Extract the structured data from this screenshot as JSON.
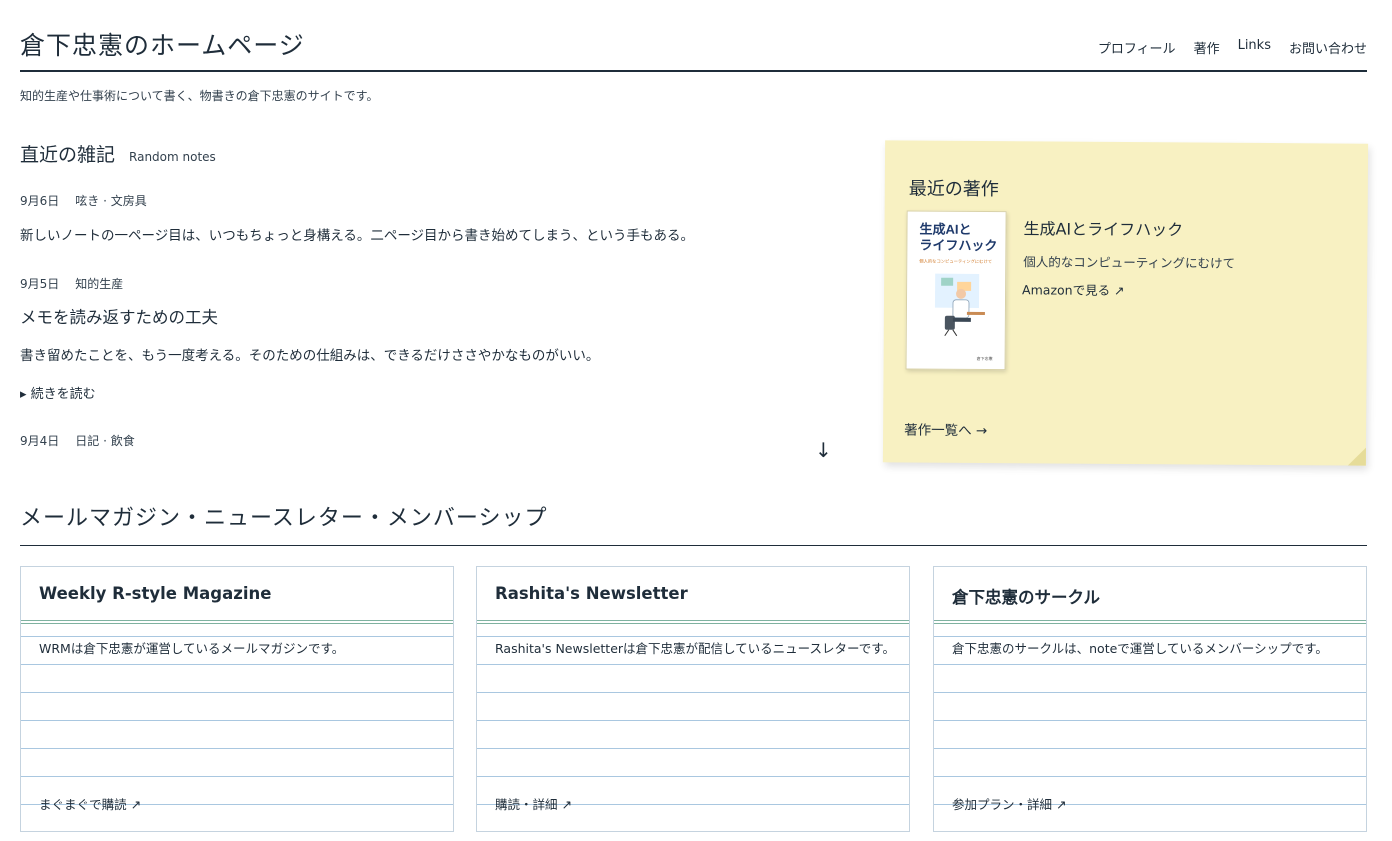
{
  "header": {
    "site_title": "倉下忠憲のホームページ",
    "nav": [
      "プロフィール",
      "著作",
      "Links",
      "お問い合わせ"
    ],
    "tagline": "知的生産や仕事術について書く、物書きの倉下忠憲のサイトです。"
  },
  "notes": {
    "heading": "直近の雑記",
    "heading_sub": "Random notes",
    "entries": [
      {
        "date": "9月6日",
        "tags": "呟き · 文房具",
        "body": "新しいノートの一ページ目は、いつもちょっと身構える。二ページ目から書き始めてしまう、という手もある。"
      },
      {
        "date": "9月5日",
        "tags": "知的生産",
        "title": "メモを読み返すための工夫",
        "body": "書き留めたことを、もう一度考える。そのための仕組みは、できるだけささやかなものがいい。",
        "readmore": "▸ 続きを読む"
      },
      {
        "date": "9月4日",
        "tags": "日記 · 飲食"
      }
    ],
    "scroll_arrow": "↓"
  },
  "books": {
    "heading": "最近の著作",
    "book_title": "生成AIとライフハック",
    "book_subtitle": "個人的なコンピューティングにむけて",
    "amazon_link": "Amazonで見る ↗",
    "all_link": "著作一覧へ →",
    "cover": {
      "title_line1": "生成AIと",
      "title_line2": "ライフハック",
      "subtitle": "個人的なコンピューティングにむけて",
      "author": "倉下忠憲"
    }
  },
  "newsletter": {
    "heading": "メールマガジン・ニュースレター・メンバーシップ",
    "cards": [
      {
        "title": "Weekly R-style Magazine",
        "desc": "WRMは倉下忠憲が運営しているメールマガジンです。",
        "link": "まぐまぐで購読 ↗"
      },
      {
        "title": "Rashita's Newsletter",
        "desc": "Rashita's Newsletterは倉下忠憲が配信しているニュースレターです。",
        "link": "購読・詳細 ↗"
      },
      {
        "title": "倉下忠憲のサークル",
        "desc": "倉下忠憲のサークルは、noteで運営しているメンバーシップです。",
        "link": "参加プラン・詳細 ↗"
      }
    ]
  },
  "colors": {
    "ink": "#1f2d3a",
    "sticky": "#f8f1c2",
    "card_rule": "#a9c7e0"
  }
}
